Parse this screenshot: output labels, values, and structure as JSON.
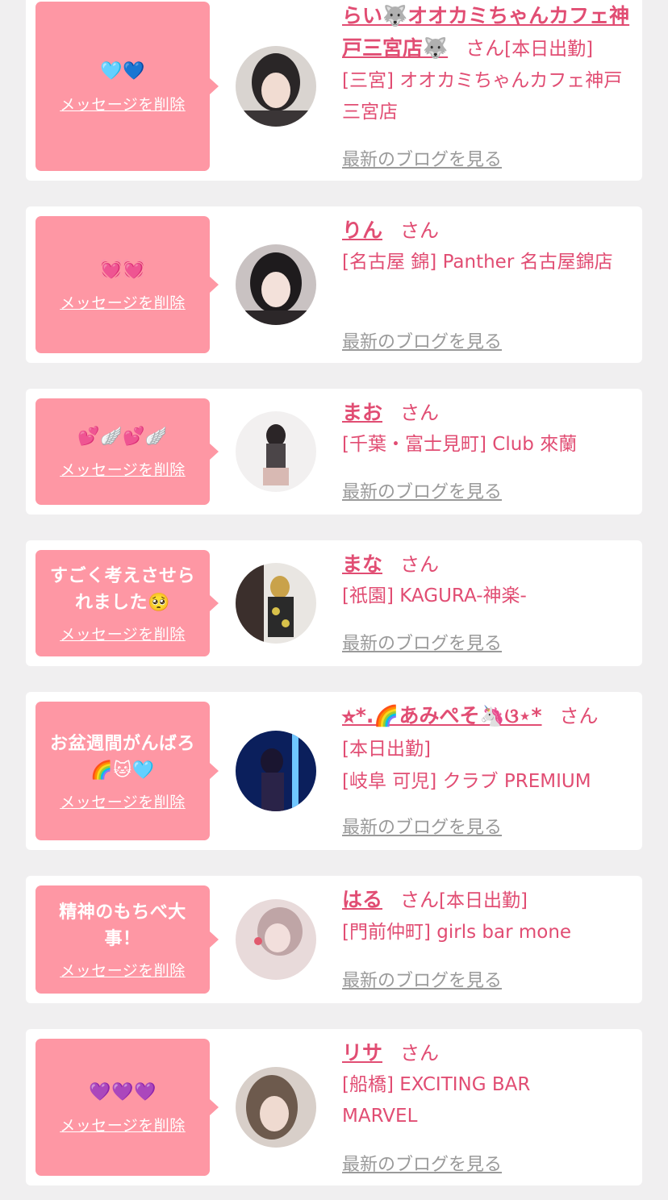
{
  "delete_label": "メッセージを削除",
  "blog_label": "最新のブログを見る",
  "san_label": "さん",
  "entries": [
    {
      "message": "🩵💙",
      "name": "らい🐺オオカミちゃんカフェ神戸三宮店🐺",
      "status": "[本日出勤]",
      "shop": "[三宮] オオカミちゃんカフェ神戸三宮店"
    },
    {
      "message": "💓💓",
      "name": "りん",
      "status": "",
      "shop": "[名古屋 錦] Panther 名古屋錦店"
    },
    {
      "message": "💕🪽💕🪽",
      "name": "まお",
      "status": "",
      "shop": "[千葉・富士見町] Club 來蘭"
    },
    {
      "message": "すごく考えさせられました🥺",
      "name": "まな",
      "status": "",
      "shop": "[祇園] KAGURA-神楽-"
    },
    {
      "message": "お盆週間がんばろ🌈🐱🩵",
      "name": "⭐︎*.🌈あみぺそ🦄ଓ⋆*",
      "status": "[本日出勤]",
      "shop": "[岐阜 可児] クラブ PREMIUM"
    },
    {
      "message": "精神のもちべ大事！",
      "name": "はる",
      "status": "[本日出勤]",
      "shop": "[門前仲町] girls bar mone"
    },
    {
      "message": "💜💜💜",
      "name": "リサ",
      "status": "",
      "shop": "[船橋] EXCITING BAR MARVEL"
    }
  ],
  "colors": {
    "bubble": "#fe97a4",
    "accent": "#e14d73",
    "link_gray": "#9a9a9a",
    "background": "#f0eff0"
  }
}
